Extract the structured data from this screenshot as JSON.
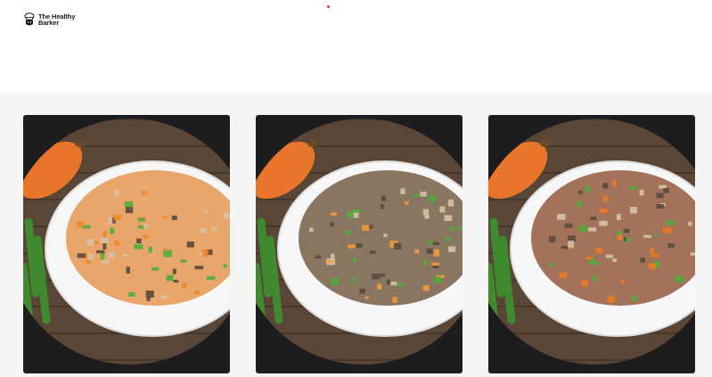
{
  "header": {
    "logo": {
      "line1": "The Healthy",
      "line2": "Barker"
    }
  },
  "products": {
    "cards": [
      {
        "image": "chicken-veggie-bowl",
        "food_color": "#e8a66a",
        "accent": "#f08a2c"
      },
      {
        "image": "beef-veggie-bowl",
        "food_color": "#8a7560",
        "accent": "#f39a3a"
      },
      {
        "image": "turkey-veggie-bowl",
        "food_color": "#a2735a",
        "accent": "#f07a22"
      }
    ]
  },
  "colors": {
    "brand_dot": "#d32f2f",
    "card_bg": "#1d1d1f",
    "section_bg": "#f5f5f5",
    "wood": "#5a4636"
  }
}
